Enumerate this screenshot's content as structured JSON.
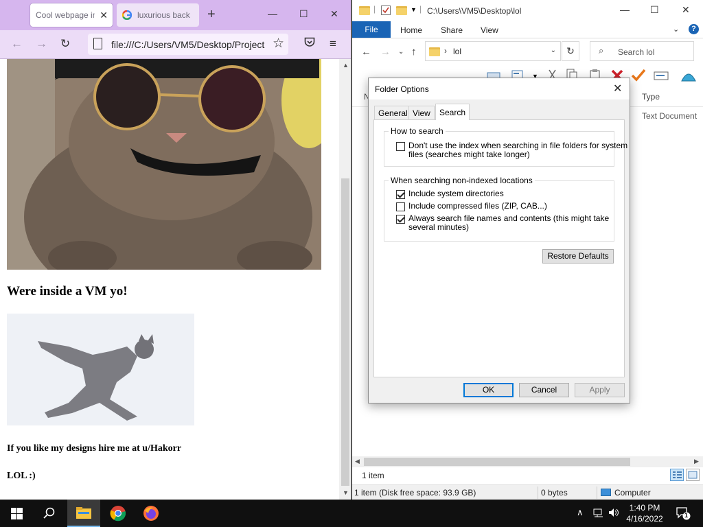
{
  "firefox": {
    "tabs": [
      {
        "title": "Cool webpage in",
        "active": true
      },
      {
        "title": "luxurious back",
        "active": false
      }
    ],
    "url": "file:///C:/Users/VM5/Desktop/Project",
    "page": {
      "heading": "Were inside a VM yo!",
      "paragraph1": "If you like my designs hire me at u/Hakorr",
      "paragraph2": "LOL :)"
    }
  },
  "explorer": {
    "title_path": "C:\\Users\\VM5\\Desktop\\lol",
    "ribbon_tabs": [
      "File",
      "Home",
      "Share",
      "View"
    ],
    "address": {
      "folder": "lol"
    },
    "search_placeholder": "Search lol",
    "list": {
      "column_type": "Type",
      "column_name_partial": "N",
      "row_type": "Text Document"
    },
    "item_count": "1 item",
    "status": {
      "summary": "1 item (Disk free space: 93.9 GB)",
      "size": "0 bytes",
      "location": "Computer"
    }
  },
  "dialog": {
    "title": "Folder Options",
    "tabs": [
      "General",
      "View",
      "Search"
    ],
    "active_tab": "Search",
    "group1": {
      "legend": "How to search",
      "options": [
        {
          "line1": "Don't use the index when searching in file folders for system",
          "line2": "files (searches might take longer)",
          "checked": false
        }
      ]
    },
    "group2": {
      "legend": "When searching non-indexed locations",
      "options": [
        {
          "line1": "Include system directories",
          "line2": "",
          "checked": true
        },
        {
          "line1": "Include compressed files (ZIP, CAB...)",
          "line2": "",
          "checked": false
        },
        {
          "line1": "Always search file names and contents (this might take",
          "line2": "several minutes)",
          "checked": true
        }
      ]
    },
    "restore_defaults": "Restore Defaults",
    "buttons": {
      "ok": "OK",
      "cancel": "Cancel",
      "apply": "Apply"
    }
  },
  "taskbar": {
    "time": "1:40 PM",
    "date": "4/16/2022",
    "notification_count": "1"
  },
  "colors": {
    "firefox_tabbar": "#d6b6ee",
    "firefox_navbar": "#ecdcf7",
    "explorer_file_tab": "#1a64b5",
    "primary_button_border": "#0078d7",
    "taskbar": "#101010"
  }
}
